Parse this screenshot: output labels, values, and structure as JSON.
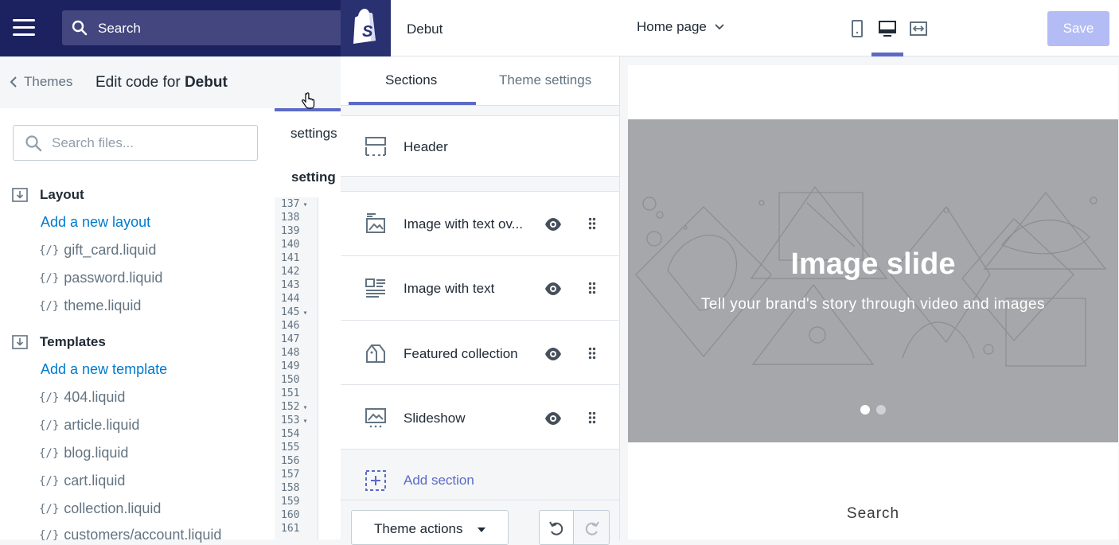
{
  "admin": {
    "search_placeholder": "Search"
  },
  "code_editor": {
    "back_label": "Themes",
    "title_prefix": "Edit code for ",
    "title_theme": "Debut",
    "file_search_placeholder": "Search files...",
    "folders": [
      {
        "name": "Layout",
        "add_label": "Add a new layout",
        "files": [
          "gift_card.liquid",
          "password.liquid",
          "theme.liquid"
        ]
      },
      {
        "name": "Templates",
        "add_label": "Add a new template",
        "files": [
          "404.liquid",
          "article.liquid",
          "blog.liquid",
          "cart.liquid",
          "collection.liquid",
          "customers/account.liquid"
        ]
      }
    ],
    "file_icon": "{/}",
    "tab_label": "settings",
    "section_label": "setting",
    "line_numbers": [
      "137",
      "138",
      "139",
      "140",
      "141",
      "142",
      "143",
      "144",
      "145",
      "146",
      "147",
      "148",
      "149",
      "150",
      "151",
      "152",
      "153",
      "154",
      "155",
      "156",
      "157",
      "158",
      "159",
      "160",
      "161"
    ],
    "folded_lines": [
      "137",
      "145",
      "152",
      "153"
    ]
  },
  "customizer": {
    "theme_name": "Debut",
    "tabs": {
      "sections": "Sections",
      "theme_settings": "Theme settings"
    },
    "header_section": "Header",
    "sections": [
      {
        "label": "Image with text ov...",
        "icon": "image-overlay-icon"
      },
      {
        "label": "Image with text",
        "icon": "image-text-icon"
      },
      {
        "label": "Featured collection",
        "icon": "collection-icon"
      },
      {
        "label": "Slideshow",
        "icon": "slideshow-icon"
      }
    ],
    "add_section": "Add section",
    "theme_actions": "Theme actions"
  },
  "preview": {
    "page_select": "Home page",
    "save_label": "Save",
    "slide_title": "Image slide",
    "slide_subtitle": "Tell your brand's story through video and images",
    "search_text": "Search"
  },
  "colors": {
    "admin_nav": "#1c2260",
    "accent": "#5c6ac4",
    "link": "#007ace",
    "save_disabled": "#b3bcf5"
  }
}
